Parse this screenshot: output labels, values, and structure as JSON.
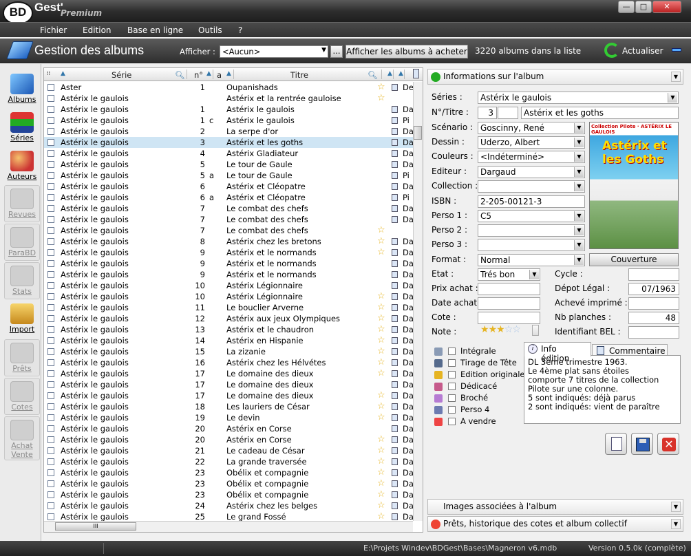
{
  "app": {
    "logo": "BD",
    "name": "Gest'",
    "edition": "Premium"
  },
  "window_buttons": {
    "min": "—",
    "max": "□",
    "close": "✕"
  },
  "menu": [
    "Fichier",
    "Edition",
    "Base en ligne",
    "Outils",
    "?"
  ],
  "toolbar": {
    "title": "Gestion des albums",
    "afficher_label": "Afficher :",
    "afficher_value": "<Aucun>",
    "dots": "...",
    "acheter_button": "Afficher les albums à acheter",
    "count": "3220 albums dans la liste",
    "refresh": "Actualiser"
  },
  "sidebar": [
    {
      "label": "Albums",
      "disabled": false
    },
    {
      "label": "Séries",
      "disabled": false
    },
    {
      "label": "Auteurs",
      "disabled": false
    },
    {
      "label": "Revues",
      "disabled": true
    },
    {
      "label": "ParaBD",
      "disabled": true
    },
    {
      "label": "Stats",
      "disabled": true
    },
    {
      "label": "Import",
      "disabled": false
    },
    {
      "label": "Prêts",
      "disabled": true
    },
    {
      "label": "Cotes",
      "disabled": true
    },
    {
      "label": "Achat Vente",
      "disabled": true
    }
  ],
  "list": {
    "headers": {
      "serie": "Série",
      "num": "n°",
      "a": "a",
      "titre": "Titre"
    },
    "rows": [
      {
        "s": "Aster",
        "n": "1",
        "a": "",
        "t": "Oupanishads",
        "star": true,
        "doc": true,
        "e": "De"
      },
      {
        "s": "Astérix le gaulois",
        "n": "",
        "a": "",
        "t": "Astérix et la rentrée gauloise",
        "star": true,
        "doc": false,
        "e": ""
      },
      {
        "s": "Astérix le gaulois",
        "n": "1",
        "a": "",
        "t": "Astérix le gaulois",
        "star": false,
        "doc": true,
        "e": "Da"
      },
      {
        "s": "Astérix le gaulois",
        "n": "1",
        "a": "c",
        "t": "Astérix le gaulois",
        "star": false,
        "doc": true,
        "e": "Pi"
      },
      {
        "s": "Astérix le gaulois",
        "n": "2",
        "a": "",
        "t": "La serpe d'or",
        "star": false,
        "doc": true,
        "e": "Da"
      },
      {
        "s": "Astérix le gaulois",
        "n": "3",
        "a": "",
        "t": "Astérix et les goths",
        "star": false,
        "doc": true,
        "e": "Da",
        "sel": true
      },
      {
        "s": "Astérix le gaulois",
        "n": "4",
        "a": "",
        "t": "Astérix Gladiateur",
        "star": false,
        "doc": true,
        "e": "Da"
      },
      {
        "s": "Astérix le gaulois",
        "n": "5",
        "a": "",
        "t": "Le tour de Gaule",
        "star": false,
        "doc": true,
        "e": "Da"
      },
      {
        "s": "Astérix le gaulois",
        "n": "5",
        "a": "a",
        "t": "Le tour de Gaule",
        "star": false,
        "doc": true,
        "e": "Pi"
      },
      {
        "s": "Astérix le gaulois",
        "n": "6",
        "a": "",
        "t": "Astérix et Cléopatre",
        "star": false,
        "doc": true,
        "e": "Da"
      },
      {
        "s": "Astérix le gaulois",
        "n": "6",
        "a": "a",
        "t": "Astérix et Cléopatre",
        "star": false,
        "doc": true,
        "e": "Pi"
      },
      {
        "s": "Astérix le gaulois",
        "n": "7",
        "a": "",
        "t": "Le combat des chefs",
        "star": false,
        "doc": true,
        "e": "Da"
      },
      {
        "s": "Astérix le gaulois",
        "n": "7",
        "a": "",
        "t": "Le combat des chefs",
        "star": false,
        "doc": true,
        "e": "Da"
      },
      {
        "s": "Astérix le gaulois",
        "n": "7",
        "a": "",
        "t": "Le combat des chefs",
        "star": true,
        "doc": false,
        "e": ""
      },
      {
        "s": "Astérix le gaulois",
        "n": "8",
        "a": "",
        "t": "Astérix chez les bretons",
        "star": true,
        "doc": true,
        "e": "Da"
      },
      {
        "s": "Astérix le gaulois",
        "n": "9",
        "a": "",
        "t": "Astérix et le normands",
        "star": true,
        "doc": true,
        "e": "Da"
      },
      {
        "s": "Astérix le gaulois",
        "n": "9",
        "a": "",
        "t": "Astérix et le normands",
        "star": false,
        "doc": true,
        "e": "Da"
      },
      {
        "s": "Astérix le gaulois",
        "n": "9",
        "a": "",
        "t": "Astérix et le normands",
        "star": false,
        "doc": true,
        "e": "Da"
      },
      {
        "s": "Astérix le gaulois",
        "n": "10",
        "a": "",
        "t": "Astérix Légionnaire",
        "star": false,
        "doc": true,
        "e": "Da"
      },
      {
        "s": "Astérix le gaulois",
        "n": "10",
        "a": "",
        "t": "Astérix Légionnaire",
        "star": true,
        "doc": true,
        "e": "Da"
      },
      {
        "s": "Astérix le gaulois",
        "n": "11",
        "a": "",
        "t": "Le bouclier Arverne",
        "star": true,
        "doc": true,
        "e": "Da"
      },
      {
        "s": "Astérix le gaulois",
        "n": "12",
        "a": "",
        "t": "Astérix aux jeux Olympiques",
        "star": true,
        "doc": true,
        "e": "Da"
      },
      {
        "s": "Astérix le gaulois",
        "n": "13",
        "a": "",
        "t": "Astérix et le chaudron",
        "star": true,
        "doc": true,
        "e": "Da"
      },
      {
        "s": "Astérix le gaulois",
        "n": "14",
        "a": "",
        "t": "Astérix en Hispanie",
        "star": true,
        "doc": true,
        "e": "Da"
      },
      {
        "s": "Astérix le gaulois",
        "n": "15",
        "a": "",
        "t": "La zizanie",
        "star": true,
        "doc": true,
        "e": "Da"
      },
      {
        "s": "Astérix le gaulois",
        "n": "16",
        "a": "",
        "t": "Astérix chez les Hélvétes",
        "star": true,
        "doc": true,
        "e": "Da"
      },
      {
        "s": "Astérix le gaulois",
        "n": "17",
        "a": "",
        "t": "Le domaine des dieux",
        "star": true,
        "doc": true,
        "e": "Da"
      },
      {
        "s": "Astérix le gaulois",
        "n": "17",
        "a": "",
        "t": "Le domaine des dieux",
        "star": false,
        "doc": true,
        "e": "Da"
      },
      {
        "s": "Astérix le gaulois",
        "n": "17",
        "a": "",
        "t": "Le domaine des dieux",
        "star": true,
        "doc": true,
        "e": "Da"
      },
      {
        "s": "Astérix le gaulois",
        "n": "18",
        "a": "",
        "t": "Les lauriers de César",
        "star": true,
        "doc": true,
        "e": "Da"
      },
      {
        "s": "Astérix le gaulois",
        "n": "19",
        "a": "",
        "t": "Le devin",
        "star": true,
        "doc": true,
        "e": "Da"
      },
      {
        "s": "Astérix le gaulois",
        "n": "20",
        "a": "",
        "t": "Astérix en Corse",
        "star": false,
        "doc": true,
        "e": "Da"
      },
      {
        "s": "Astérix le gaulois",
        "n": "20",
        "a": "",
        "t": "Astérix en Corse",
        "star": true,
        "doc": true,
        "e": "Da"
      },
      {
        "s": "Astérix le gaulois",
        "n": "21",
        "a": "",
        "t": "Le cadeau de César",
        "star": true,
        "doc": true,
        "e": "Da"
      },
      {
        "s": "Astérix le gaulois",
        "n": "22",
        "a": "",
        "t": "La grande traversée",
        "star": true,
        "doc": true,
        "e": "Da"
      },
      {
        "s": "Astérix le gaulois",
        "n": "23",
        "a": "",
        "t": "Obélix et compagnie",
        "star": true,
        "doc": true,
        "e": "Da"
      },
      {
        "s": "Astérix le gaulois",
        "n": "23",
        "a": "",
        "t": "Obélix et compagnie",
        "star": true,
        "doc": true,
        "e": "Da"
      },
      {
        "s": "Astérix le gaulois",
        "n": "23",
        "a": "",
        "t": "Obélix et compagnie",
        "star": true,
        "doc": true,
        "e": "Da"
      },
      {
        "s": "Astérix le gaulois",
        "n": "24",
        "a": "",
        "t": "Astérix chez les belges",
        "star": true,
        "doc": true,
        "e": "Da"
      },
      {
        "s": "Astérix le gaulois",
        "n": "25",
        "a": "",
        "t": "Le grand Fossé",
        "star": true,
        "doc": true,
        "e": "Da"
      }
    ],
    "hthumb": "III"
  },
  "info": {
    "section_title": "Informations sur l'album",
    "labels": {
      "series": "Séries :",
      "num_titre": "N°/Titre :",
      "scenario": "Scénario :",
      "dessin": "Dessin :",
      "couleurs": "Couleurs :",
      "editeur": "Editeur :",
      "collection": "Collection :",
      "isbn": "ISBN :",
      "perso1": "Perso 1 :",
      "perso2": "Perso 2 :",
      "perso3": "Perso 3 :",
      "format": "Format :",
      "etat": "Etat :",
      "prix": "Prix achat :",
      "date_achat": "Date achat",
      "cote": "Cote :",
      "note": "Note :",
      "cycle": "Cycle :",
      "depot": "Dépot Légal :",
      "acheve": "Achevé imprimé :",
      "planches": "Nb planches :",
      "bel": "Identifiant BEL :"
    },
    "values": {
      "series": "Astérix le gaulois",
      "num": "3",
      "num2": "",
      "titre": "Astérix et les goths",
      "scenario": "Goscinny, René",
      "dessin": "Uderzo, Albert",
      "couleurs": "<Indéterminé>",
      "editeur": "Dargaud",
      "collection": "",
      "isbn": "2-205-00121-3",
      "perso1": "C5",
      "perso2": "",
      "perso3": "",
      "format": "Normal",
      "etat": "Trés bon",
      "prix": "",
      "date_achat": "",
      "cote": "",
      "cycle": "",
      "depot": "07/1963",
      "acheve": "",
      "planches": "48",
      "bel": ""
    },
    "note_stars": 3,
    "cover": {
      "banner": "Collection Pilote · ASTÉRIX LE GAULOIS",
      "title": "Astérix et les Goths"
    },
    "cover_button": "Couverture",
    "flags": [
      {
        "label": "Intégrale",
        "checked": false
      },
      {
        "label": "Tirage de Tête",
        "checked": false
      },
      {
        "label": "Edition originale",
        "checked": false
      },
      {
        "label": "Dédicacé",
        "checked": false
      },
      {
        "label": "Broché",
        "checked": false
      },
      {
        "label": "Perso 4",
        "checked": false
      },
      {
        "label": "A vendre",
        "checked": false
      }
    ],
    "tabs": [
      "Info édition",
      "Commentaire"
    ],
    "notes": "DL 3ème trimestre 1963.\nLe 4ème plat sans étoiles comporte 7 titres de la collection Pilote sur une colonne.\n5 sont indiqués: déjà parus\n2 sont indiqués: vient de paraître",
    "images_section": "Images associées à l'album",
    "prets_section": "Prêts, historique des cotes et album collectif"
  },
  "status": {
    "path": "E:\\Projets Windev\\BDGest\\Bases\\Magneron v6.mdb",
    "version": "Version 0.5.0k (complète)"
  }
}
